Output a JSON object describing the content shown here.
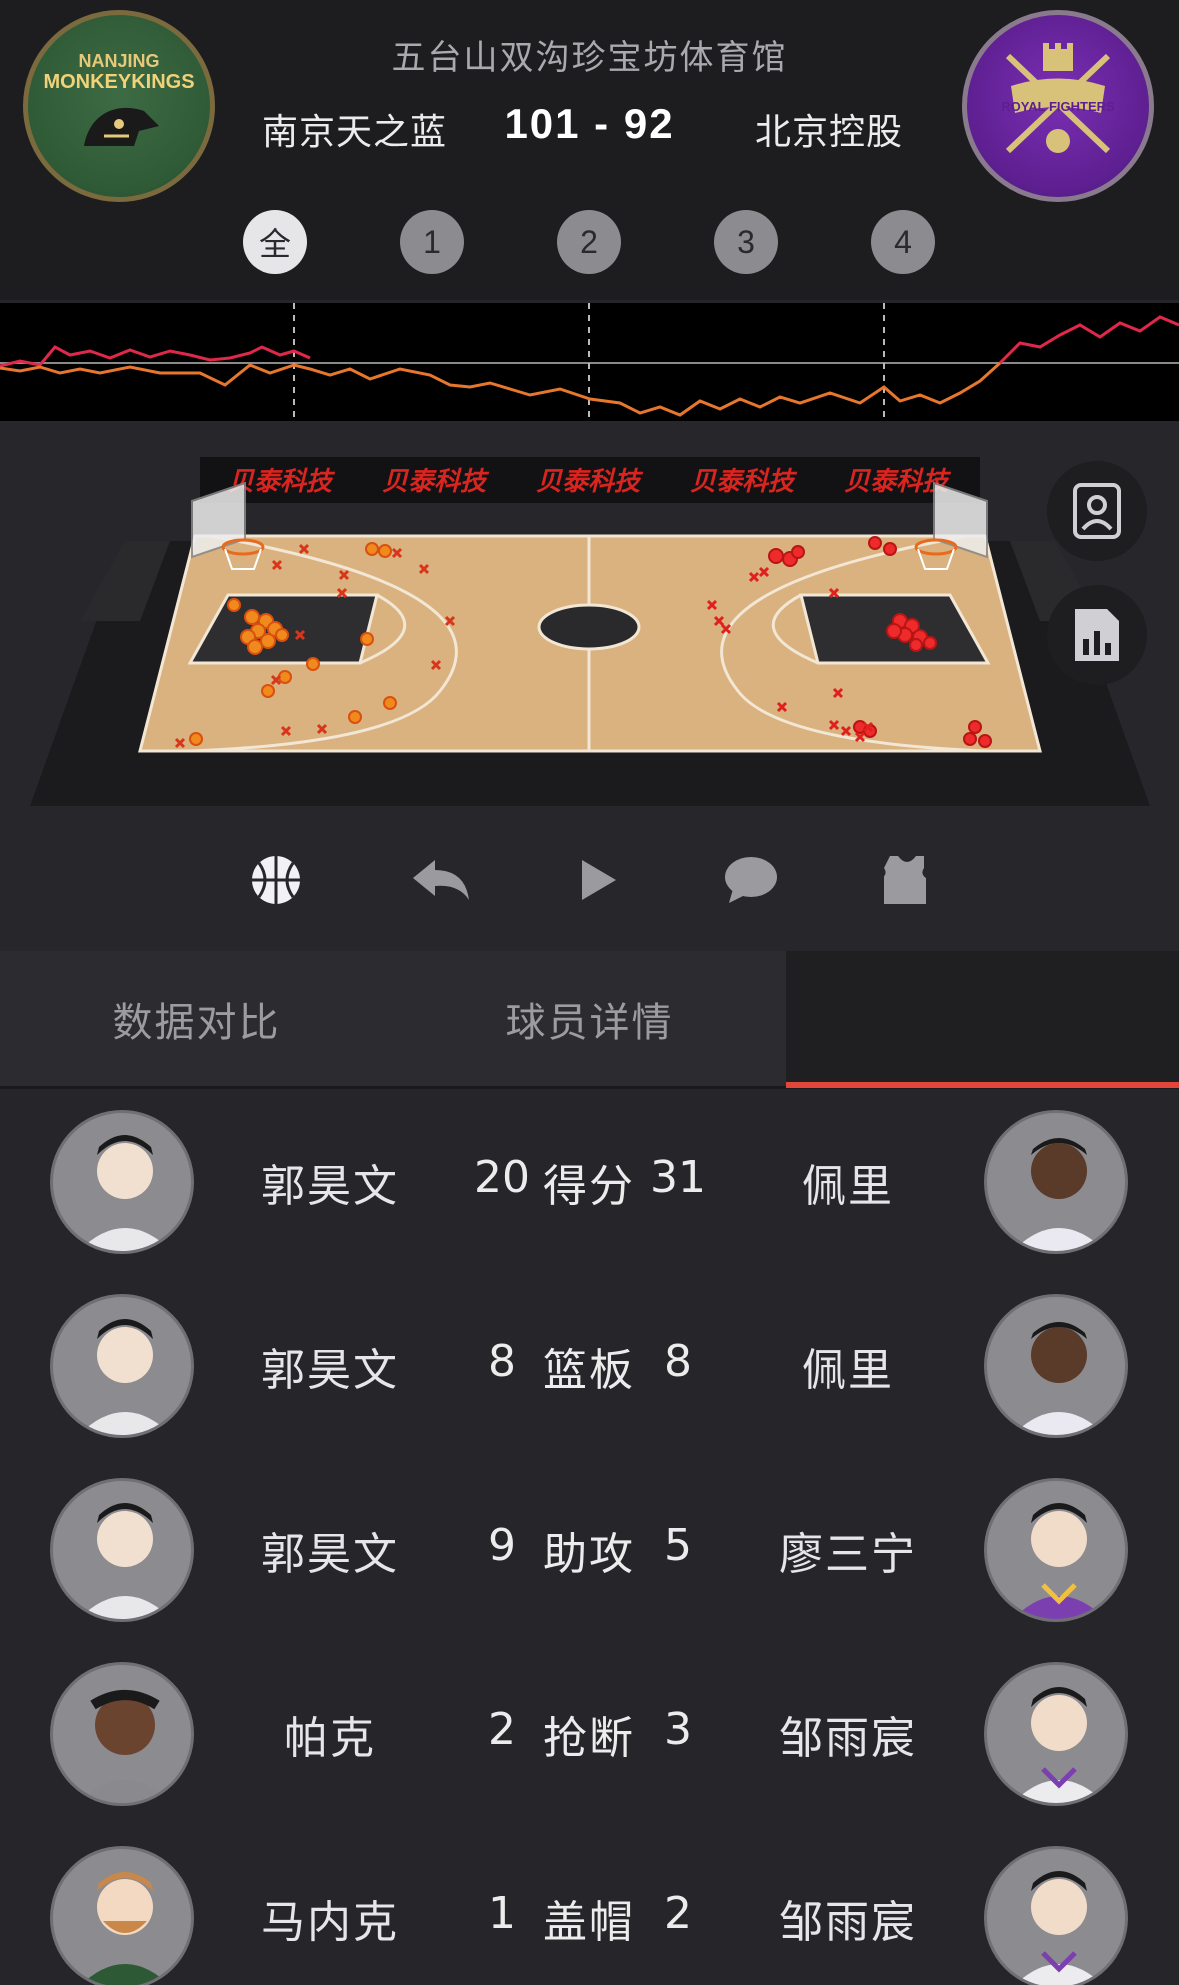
{
  "header": {
    "venue": "五台山双沟珍宝坊体育馆",
    "home_team": "南京天之蓝",
    "away_team": "北京控股",
    "score": "101 -  92",
    "home_logo_text_top": "NANJING",
    "home_logo_text_main": "MONKEYKINGS",
    "away_logo_text": "ROYAL FIGHTERS",
    "periods": [
      "全",
      "1",
      "2",
      "3",
      "4"
    ],
    "active_period": "全"
  },
  "sponsor": {
    "banner_text": "贝泰科技"
  },
  "controls": {
    "icons": [
      "basketball-icon",
      "undo-icon",
      "play-icon",
      "comment-icon",
      "jersey-icon"
    ]
  },
  "side_buttons": [
    "player-profile-icon",
    "stats-chart-icon"
  ],
  "tabs": [
    {
      "label": "数据对比"
    },
    {
      "label": "球员详情"
    },
    {
      "label": ""
    }
  ],
  "colors": {
    "accent": "#e0463a",
    "home_trend": "#e8772e",
    "away_trend": "#e0284a"
  },
  "comparisons": [
    {
      "home_player": "郭昊文",
      "home_value": "20",
      "stat": "得分",
      "away_value": "31",
      "away_player": "佩里"
    },
    {
      "home_player": "郭昊文",
      "home_value": "8",
      "stat": "篮板",
      "away_value": "8",
      "away_player": "佩里"
    },
    {
      "home_player": "郭昊文",
      "home_value": "9",
      "stat": "助攻",
      "away_value": "5",
      "away_player": "廖三宁"
    },
    {
      "home_player": "帕克",
      "home_value": "2",
      "stat": "抢断",
      "away_value": "3",
      "away_player": "邹雨宸"
    },
    {
      "home_player": "马内克",
      "home_value": "1",
      "stat": "盖帽",
      "away_value": "2",
      "away_player": "邹雨宸"
    }
  ]
}
